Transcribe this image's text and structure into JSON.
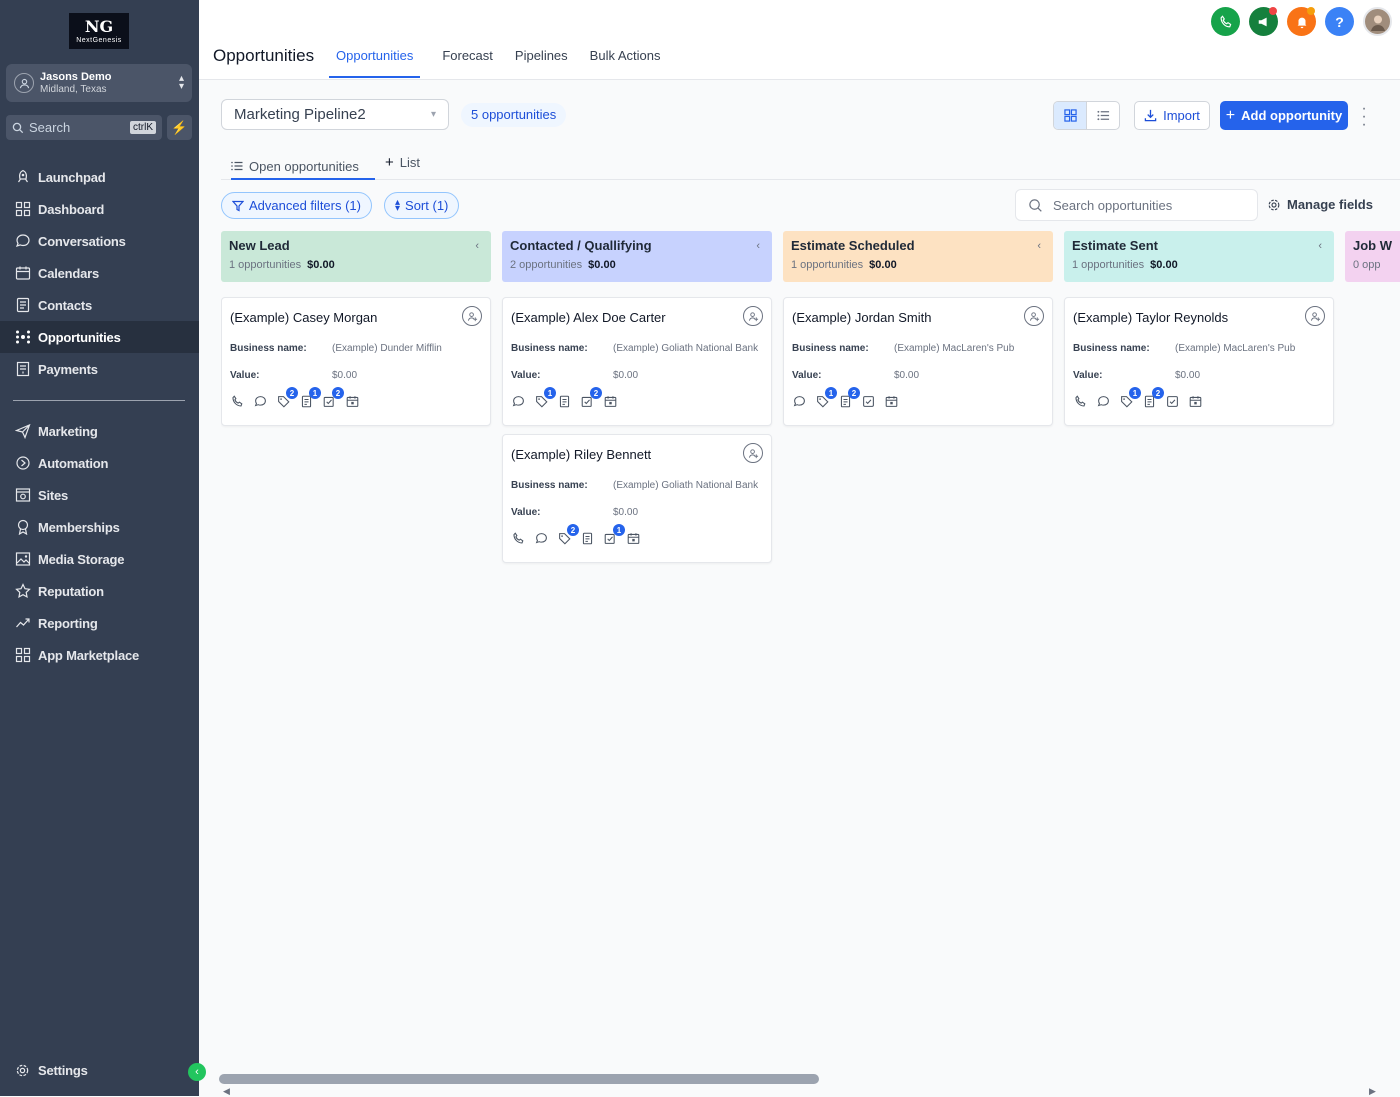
{
  "brand": {
    "logo_mark": "NG",
    "logo_text": "NextGenesis"
  },
  "account": {
    "name": "Jasons Demo",
    "location": "Midland, Texas"
  },
  "sidebar_search": {
    "placeholder": "Search",
    "shortcut": "ctrlK"
  },
  "nav_primary": [
    {
      "label": "Launchpad",
      "icon": "rocket-icon"
    },
    {
      "label": "Dashboard",
      "icon": "dashboard-icon"
    },
    {
      "label": "Conversations",
      "icon": "chat-icon"
    },
    {
      "label": "Calendars",
      "icon": "calendar-icon"
    },
    {
      "label": "Contacts",
      "icon": "contacts-icon"
    },
    {
      "label": "Opportunities",
      "icon": "opportunities-icon",
      "active": true
    },
    {
      "label": "Payments",
      "icon": "payments-icon"
    }
  ],
  "nav_secondary": [
    {
      "label": "Marketing",
      "icon": "send-icon"
    },
    {
      "label": "Automation",
      "icon": "automation-icon"
    },
    {
      "label": "Sites",
      "icon": "sites-icon"
    },
    {
      "label": "Memberships",
      "icon": "membership-icon"
    },
    {
      "label": "Media Storage",
      "icon": "media-icon"
    },
    {
      "label": "Reputation",
      "icon": "star-icon"
    },
    {
      "label": "Reporting",
      "icon": "reporting-icon"
    },
    {
      "label": "App Marketplace",
      "icon": "apps-icon"
    }
  ],
  "settings": {
    "label": "Settings"
  },
  "header": {
    "title": "Opportunities",
    "tabs": [
      "Opportunities",
      "Forecast",
      "Pipelines",
      "Bulk Actions"
    ],
    "active_tab": "Opportunities"
  },
  "toolbar": {
    "pipeline": "Marketing Pipeline2",
    "count_badge": "5 opportunities",
    "import_label": "Import",
    "add_label": "Add opportunity"
  },
  "subtabs": {
    "open": "Open opportunities",
    "list": "List"
  },
  "filters": {
    "advanced": "Advanced filters (1)",
    "sort": "Sort (1)"
  },
  "search": {
    "placeholder": "Search opportunities"
  },
  "manage_fields": "Manage fields",
  "labels": {
    "business_name": "Business name:",
    "value": "Value:"
  },
  "columns": [
    {
      "title": "New Lead",
      "count": "1 opportunities",
      "total": "$0.00",
      "color": "#c9e8d8",
      "cards": [
        {
          "name": "(Example) Casey Morgan",
          "business": "(Example) Dunder Mifflin",
          "value": "$0.00",
          "icons": [
            {
              "i": "phone"
            },
            {
              "i": "chat"
            },
            {
              "i": "tag",
              "b": "2"
            },
            {
              "i": "note",
              "b": "1"
            },
            {
              "i": "task",
              "b": "2"
            },
            {
              "i": "calendar"
            }
          ]
        }
      ]
    },
    {
      "title": "Contacted / Quallifying",
      "count": "2 opportunities",
      "total": "$0.00",
      "color": "#c7d2fe",
      "cards": [
        {
          "name": "(Example) Alex Doe Carter",
          "business": "(Example) Goliath National Bank",
          "value": "$0.00",
          "icons": [
            {
              "i": "chat"
            },
            {
              "i": "tag",
              "b": "1"
            },
            {
              "i": "note"
            },
            {
              "i": "task",
              "b": "2"
            },
            {
              "i": "calendar"
            }
          ]
        },
        {
          "name": "(Example) Riley Bennett",
          "business": "(Example) Goliath National Bank",
          "value": "$0.00",
          "icons": [
            {
              "i": "phone"
            },
            {
              "i": "chat"
            },
            {
              "i": "tag",
              "b": "2"
            },
            {
              "i": "note"
            },
            {
              "i": "task",
              "b": "1"
            },
            {
              "i": "calendar"
            }
          ]
        }
      ]
    },
    {
      "title": "Estimate Scheduled",
      "count": "1 opportunities",
      "total": "$0.00",
      "color": "#fde2c2",
      "cards": [
        {
          "name": "(Example) Jordan Smith",
          "business": "(Example) MacLaren's Pub",
          "value": "$0.00",
          "icons": [
            {
              "i": "chat"
            },
            {
              "i": "tag",
              "b": "1"
            },
            {
              "i": "note",
              "b": "2"
            },
            {
              "i": "check"
            },
            {
              "i": "calendar"
            }
          ]
        }
      ]
    },
    {
      "title": "Estimate Sent",
      "count": "1 opportunities",
      "total": "$0.00",
      "color": "#c9f0ec",
      "cards": [
        {
          "name": "(Example) Taylor Reynolds",
          "business": "(Example) MacLaren's Pub",
          "value": "$0.00",
          "icons": [
            {
              "i": "phone"
            },
            {
              "i": "chat"
            },
            {
              "i": "tag",
              "b": "1"
            },
            {
              "i": "note",
              "b": "2"
            },
            {
              "i": "check"
            },
            {
              "i": "calendar"
            }
          ]
        }
      ]
    },
    {
      "title": "Job W",
      "count": "0 opp",
      "total": "",
      "color": "#f3d2f0",
      "cards": []
    }
  ]
}
